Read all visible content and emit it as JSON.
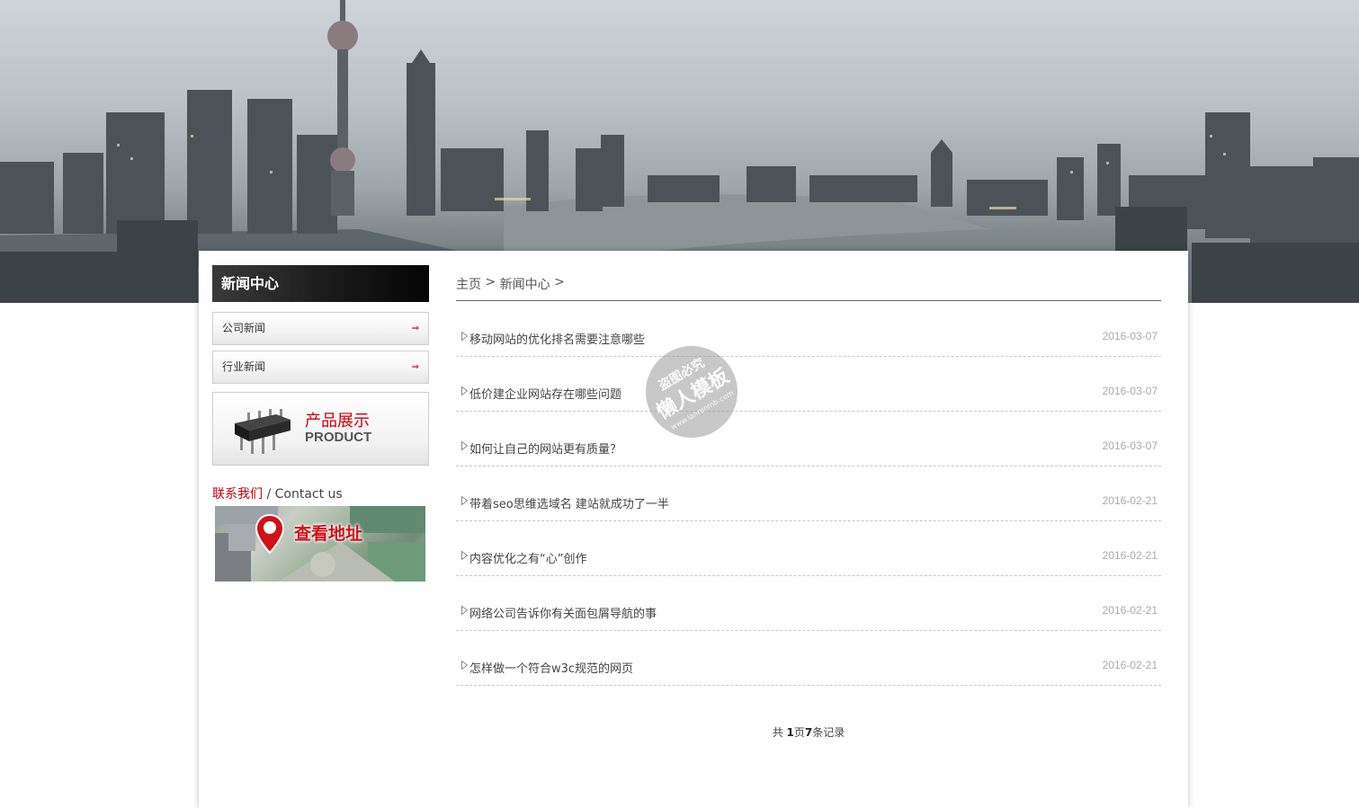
{
  "sidebar": {
    "title": "新闻中心",
    "items": [
      {
        "label": "公司新闻",
        "arrow": "⇒"
      },
      {
        "label": "行业新闻",
        "arrow": "⇒"
      }
    ],
    "product": {
      "cn": "产品展示",
      "en": "PRODUCT"
    },
    "contact": {
      "red": "联系我们",
      "sep": " / ",
      "en": "Contact us"
    },
    "map": {
      "label": "查看地址"
    }
  },
  "breadcrumb": {
    "home": "主页",
    "sep1": " > ",
    "current": "新闻中心",
    "sep2": " >"
  },
  "news": [
    {
      "title": "移动网站的优化排名需要注意哪些",
      "date": "2016-03-07"
    },
    {
      "title": "低价建企业网站存在哪些问题",
      "date": "2016-03-07"
    },
    {
      "title": "如何让自己的网站更有质量？",
      "date": "2016-03-07"
    },
    {
      "title": "带着seo思维选域名 建站就成功了一半",
      "date": "2016-02-21"
    },
    {
      "title": "内容优化之有“心”创作",
      "date": "2016-02-21"
    },
    {
      "title": "网络公司告诉你有关面包屑导航的事",
      "date": "2016-02-21"
    },
    {
      "title": "怎样做一个符合w3c规范的网页",
      "date": "2016-02-21"
    }
  ],
  "pager": {
    "prefix": "共 ",
    "pages": "1",
    "mid": "页",
    "count": "7",
    "suffix": "条记录"
  },
  "watermark": {
    "line1": "盗图必究",
    "line2": "懒人模板",
    "line3": "www.lanrenmb.com"
  },
  "colors": {
    "accent": "#c8000a",
    "title_bar": "#111111",
    "date": "#aaaaaa"
  }
}
